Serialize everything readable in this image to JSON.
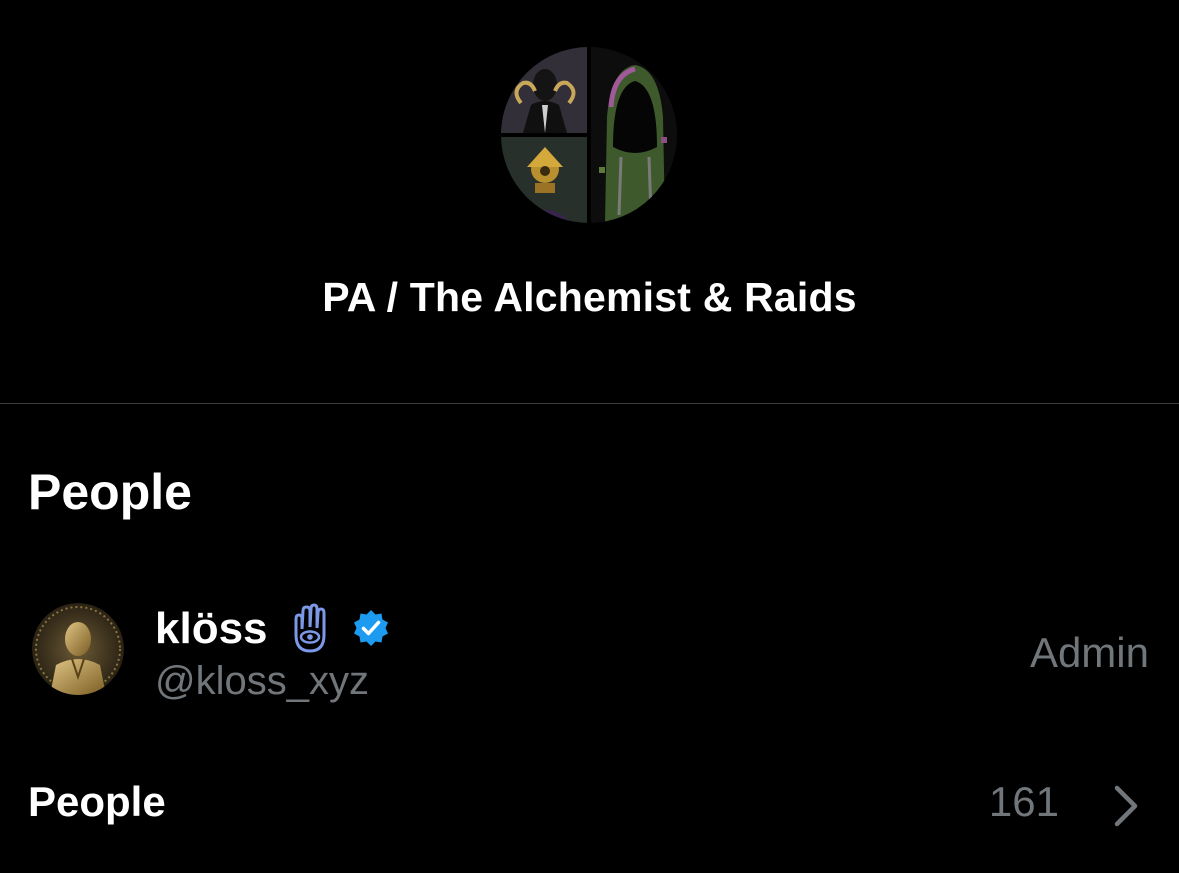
{
  "group": {
    "avatar_icon": "group-collage-avatar",
    "name": "PA / The Alchemist & Raids"
  },
  "people_section": {
    "heading": "People",
    "members": [
      {
        "avatar_icon": "gold-figure-avatar",
        "display_name": "klöss",
        "badges": [
          "hamsa-icon",
          "verified-badge-icon"
        ],
        "handle": "@kloss_xyz",
        "role": "Admin"
      }
    ]
  },
  "people_row": {
    "label": "People",
    "count": "161",
    "chevron_icon": "chevron-right-icon"
  },
  "colors": {
    "background": "#000000",
    "primary_text": "#ffffff",
    "secondary_text": "#71767b",
    "divider": "#3a3d41",
    "verified_blue": "#1d9bf0",
    "hamsa_blue": "#6f8fe0"
  }
}
